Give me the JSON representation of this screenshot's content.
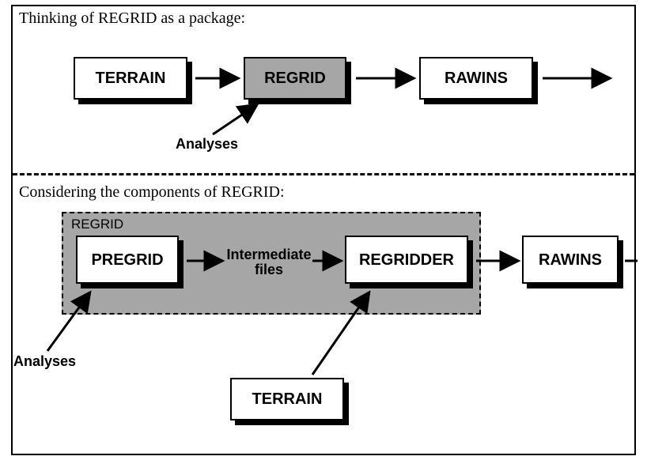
{
  "section1": {
    "caption": "Thinking of REGRID as a package:",
    "boxes": {
      "terrain": "TERRAIN",
      "regrid": "REGRID",
      "rawins": "RAWINS"
    },
    "analyses_label": "Analyses"
  },
  "section2": {
    "caption": "Considering the components of REGRID:",
    "container_title": "REGRID",
    "boxes": {
      "pregrid": "PREGRID",
      "intermediate": "Intermediate\nfiles",
      "regridder": "REGRIDDER",
      "rawins": "RAWINS",
      "terrain": "TERRAIN"
    },
    "analyses_label": "Analyses"
  }
}
